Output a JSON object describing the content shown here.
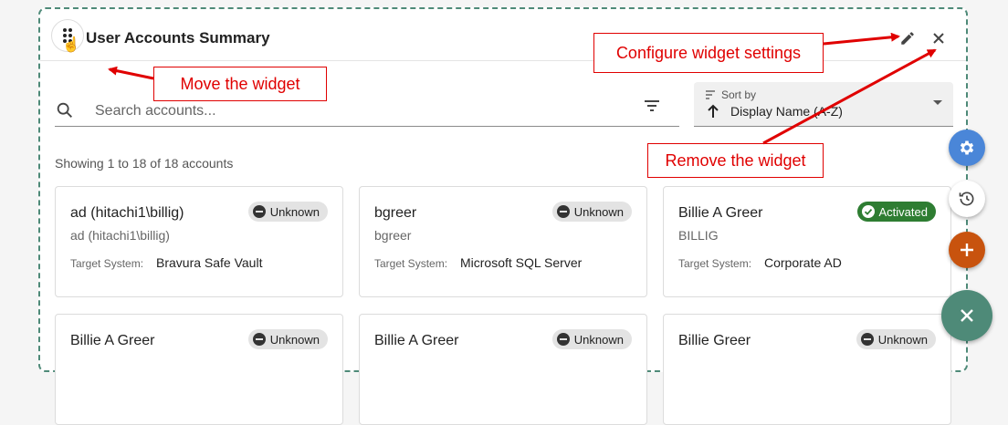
{
  "widget": {
    "title": "User Accounts Summary",
    "drag_icon": "drag-handle-dots-icon",
    "edit_icon": "pencil-icon",
    "close_icon": "close-icon"
  },
  "search": {
    "placeholder": "Search accounts..."
  },
  "sort": {
    "label": "Sort by",
    "value": "Display Name (A-Z)"
  },
  "showing": "Showing 1 to 18 of 18 accounts",
  "target_system_label": "Target System:",
  "accounts": [
    {
      "name": "ad (hitachi1\\billig)",
      "sub": "ad (hitachi1\\billig)",
      "target": "Bravura Safe Vault",
      "status": "Unknown"
    },
    {
      "name": "bgreer",
      "sub": "bgreer",
      "target": "Microsoft SQL Server",
      "status": "Unknown"
    },
    {
      "name": "Billie A Greer",
      "sub": "BILLIG",
      "target": "Corporate AD",
      "status": "Activated"
    },
    {
      "name": "Billie A Greer",
      "sub": "",
      "target": "",
      "status": "Unknown"
    },
    {
      "name": "Billie A Greer",
      "sub": "",
      "target": "",
      "status": "Unknown"
    },
    {
      "name": "Billie Greer",
      "sub": "",
      "target": "",
      "status": "Unknown"
    }
  ],
  "callouts": {
    "move": "Move the widget",
    "configure": "Configure widget settings",
    "remove": "Remove the widget"
  },
  "colors": {
    "accent_red": "#e00000",
    "activated_green": "#2e7d32",
    "fab_blue": "#4a86d8",
    "fab_orange": "#c8530e",
    "fab_teal": "#4e8a78"
  }
}
